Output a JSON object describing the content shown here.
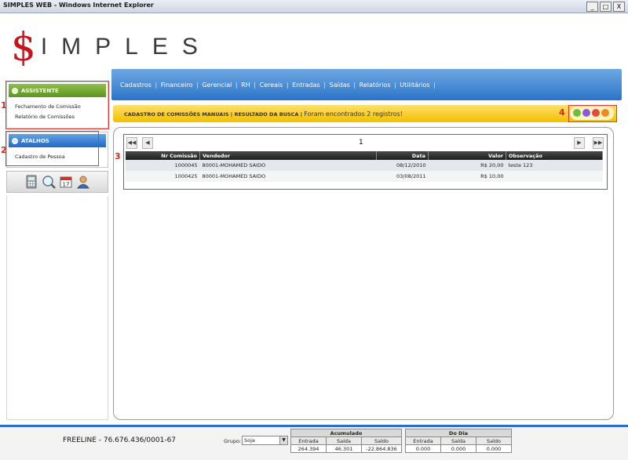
{
  "window": {
    "title": "SIMPLES WEB - Windows Internet Explorer",
    "controls": [
      "_",
      "□",
      "X"
    ]
  },
  "logo": {
    "s": "$",
    "rest": "IMPLES"
  },
  "menu": [
    "Cadastros",
    "Financeiro",
    "Gerencial",
    "RH",
    "Cereais",
    "Entradas",
    "Saídas",
    "Relatórios",
    "Utilitários"
  ],
  "assistente": {
    "title": "ASSISTENTE",
    "items": [
      "Fechamento de Comissão",
      "Relatório de Comissões"
    ]
  },
  "atalhos": {
    "title": "ATALHOS",
    "items": [
      "Cadastro de Pessoa"
    ]
  },
  "annotations": [
    "1",
    "2",
    "3",
    "4"
  ],
  "header_bar": {
    "title": "CADASTRO DE COMISSÕES MANUAIS | RESULTADO DA BUSCA |",
    "message": "Foram encontrados 2 registros!"
  },
  "pager": {
    "first": "◀◀",
    "prev": "◀",
    "page": "1",
    "next": "▶",
    "last": "▶▶"
  },
  "table": {
    "columns": [
      "Nr Comissão",
      "Vendedor",
      "Data",
      "Valor",
      "Observação"
    ],
    "rows": [
      [
        "1000045",
        "80001-MOHAMED SAIDO",
        "08/12/2010",
        "R$ 20,00",
        "teste 123"
      ],
      [
        "1000425",
        "80001-MOHAMED SAIDO",
        "03/08/2011",
        "R$ 10,00",
        ""
      ]
    ]
  },
  "footer": {
    "freeline": "FREELINE - 76.676.436/0001-67",
    "grupo_label": "Grupo:",
    "grupo_value": "Soja",
    "acumulado": {
      "title": "Acumulado",
      "labels": [
        "Entrada",
        "Saída",
        "Saldo"
      ],
      "values": [
        "264.394",
        "46.301",
        "-22.864.836"
      ]
    },
    "do_dia": {
      "title": "Do Dia",
      "labels": [
        "Entrada",
        "Saída",
        "Saldo"
      ],
      "values": [
        "0.000",
        "0.000",
        "0.000"
      ]
    }
  },
  "colors": {
    "nav_blue": "#2b74c9",
    "assistente_green": "#5e9420",
    "header_yellow": "#f1c000",
    "annotation_red": "#d52a1e",
    "logo_red": "#c0161c"
  }
}
